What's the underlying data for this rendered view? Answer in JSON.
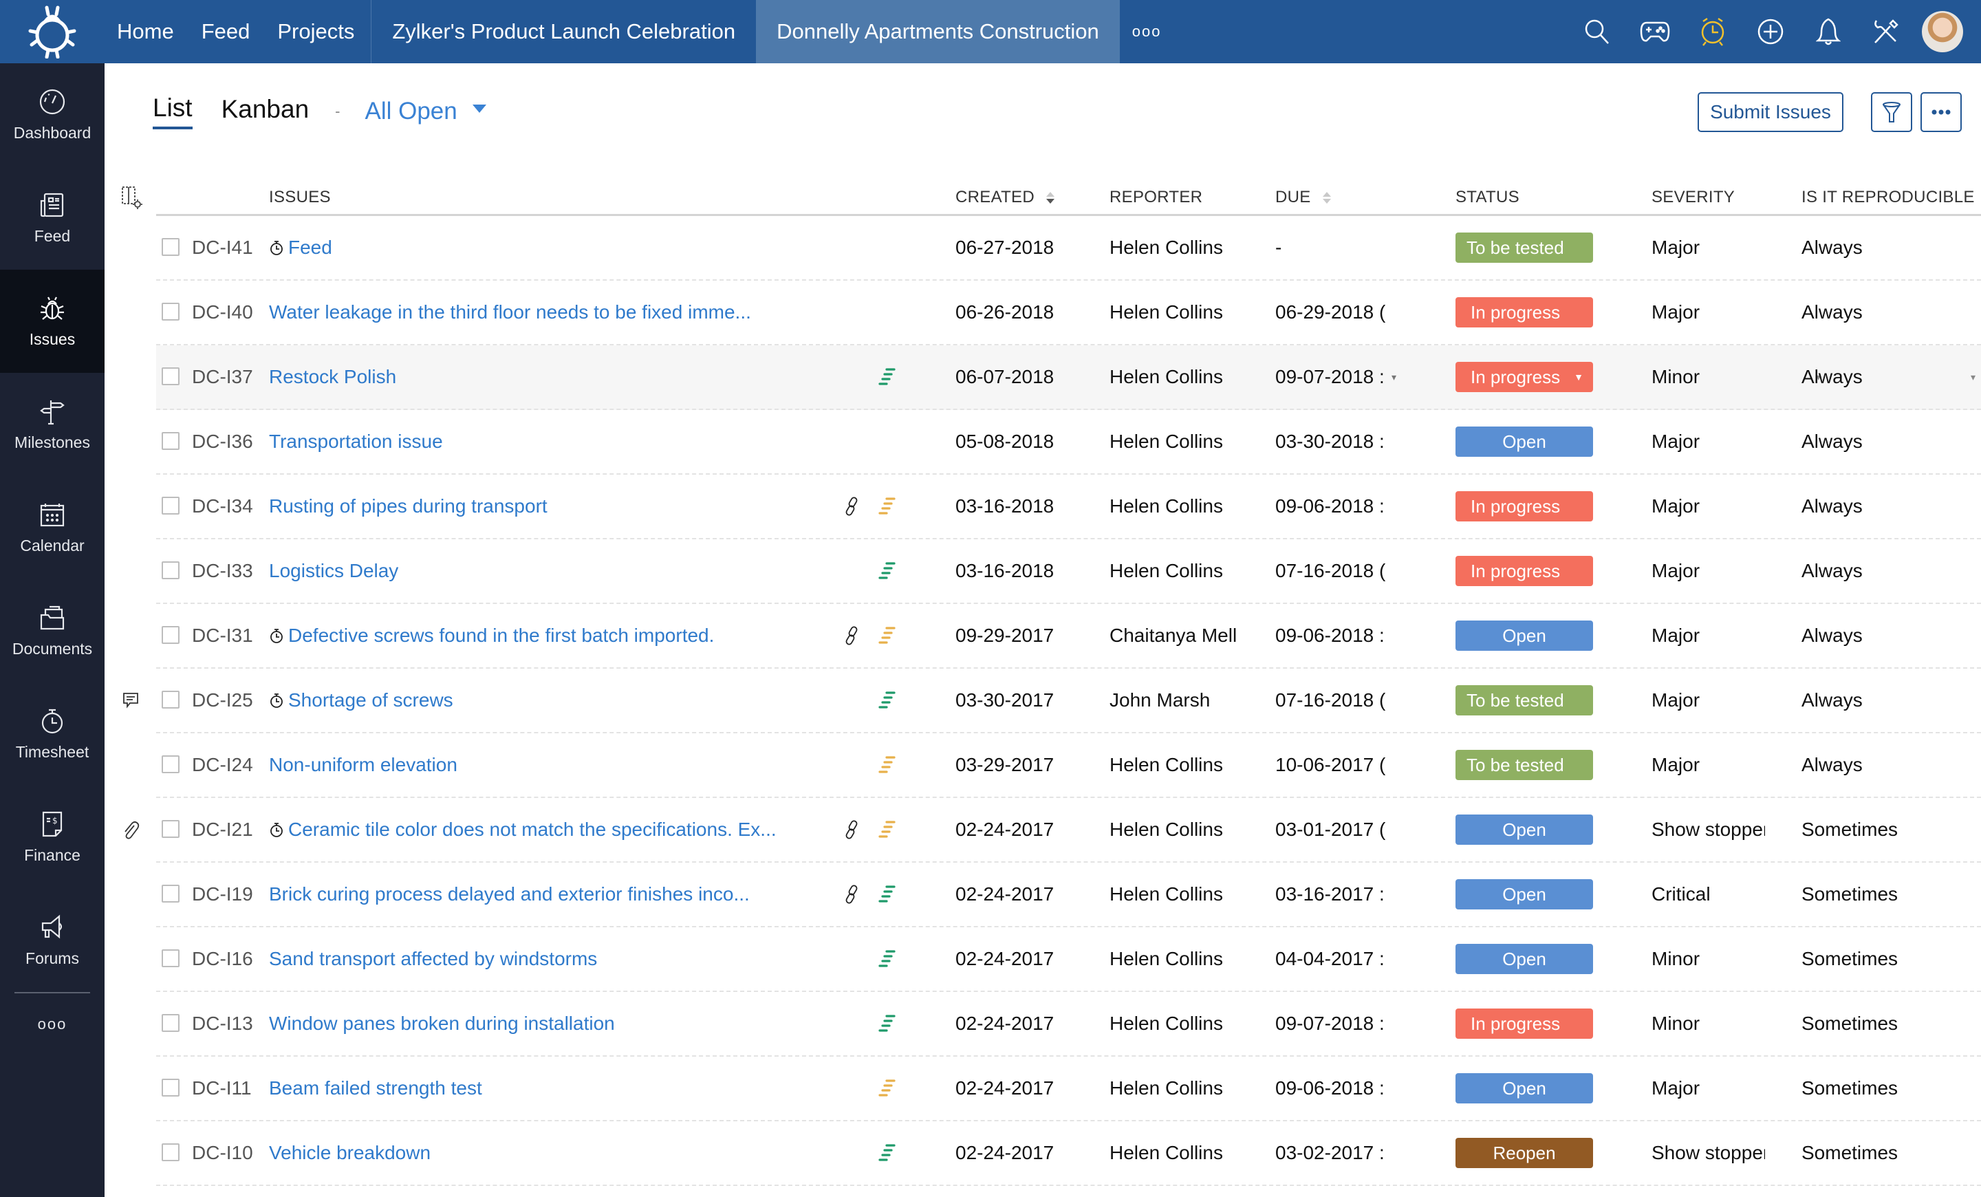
{
  "topbar": {
    "nav": [
      "Home",
      "Feed",
      "Projects"
    ],
    "projects": [
      {
        "label": "Zylker's Product Launch Celebration",
        "active": false
      },
      {
        "label": "Donnelly Apartments Construction",
        "active": true
      }
    ],
    "more": "ooo",
    "icons": [
      "search-icon",
      "game-controller-icon",
      "alarm-clock-icon",
      "add-circle-icon",
      "bell-icon",
      "tools-icon",
      "user-avatar"
    ],
    "accent_colors": {
      "bar": "#235795",
      "active_tab": "#4e7aab",
      "alarm": "#f3c12c"
    }
  },
  "sidebar": {
    "items": [
      {
        "label": "Dashboard",
        "icon": "speedometer-icon",
        "active": false
      },
      {
        "label": "Feed",
        "icon": "newspaper-icon",
        "active": false
      },
      {
        "label": "Issues",
        "icon": "bug-icon",
        "active": true
      },
      {
        "label": "Milestones",
        "icon": "signpost-icon",
        "active": false
      },
      {
        "label": "Calendar",
        "icon": "calendar-icon",
        "active": false
      },
      {
        "label": "Documents",
        "icon": "folder-icon",
        "active": false
      },
      {
        "label": "Timesheet",
        "icon": "stopwatch-icon",
        "active": false
      },
      {
        "label": "Finance",
        "icon": "invoice-icon",
        "active": false
      },
      {
        "label": "Forums",
        "icon": "megaphone-icon",
        "active": false
      }
    ],
    "more": "ooo"
  },
  "view": {
    "tabs": [
      {
        "label": "List",
        "active": true
      },
      {
        "label": "Kanban",
        "active": false
      }
    ],
    "separator": "-",
    "filter": "All Open",
    "submit_label": "Submit Issues",
    "filter_icon": "funnel-icon",
    "more_icon": "more-dots-icon"
  },
  "table": {
    "columns": {
      "issues": "ISSUES",
      "created": "CREATED",
      "reporter": "REPORTER",
      "due": "DUE",
      "status": "STATUS",
      "severity": "SEVERITY",
      "reproducible": "IS IT REPRODUCIBLE"
    },
    "sorted_by": "created",
    "rows": [
      {
        "id": "DC-I41",
        "title": "Feed",
        "timer": true,
        "link": false,
        "priority": "",
        "mark": "",
        "created": "06-27-2018",
        "reporter": "Helen Collins",
        "due": "-",
        "status": "To be tested",
        "severity": "Major",
        "reproducible": "Always"
      },
      {
        "id": "DC-I40",
        "title": "Water leakage in the third floor needs to be fixed imme...",
        "timer": false,
        "link": false,
        "priority": "",
        "mark": "",
        "created": "06-26-2018",
        "reporter": "Helen Collins",
        "due": "06-29-2018 (",
        "status": "In progress",
        "severity": "Major",
        "reproducible": "Always"
      },
      {
        "id": "DC-I37",
        "title": "Restock Polish",
        "timer": false,
        "link": false,
        "priority": "low",
        "mark": "",
        "created": "06-07-2018",
        "reporter": "Helen Collins",
        "due": "09-07-2018 :",
        "status": "In progress",
        "severity": "Minor",
        "reproducible": "Always",
        "hovered": true
      },
      {
        "id": "DC-I36",
        "title": "Transportation issue",
        "timer": false,
        "link": false,
        "priority": "",
        "mark": "",
        "created": "05-08-2018",
        "reporter": "Helen Collins",
        "due": "03-30-2018 :",
        "status": "Open",
        "severity": "Major",
        "reproducible": "Always"
      },
      {
        "id": "DC-I34",
        "title": "Rusting of pipes during transport",
        "timer": false,
        "link": true,
        "priority": "medium",
        "mark": "",
        "created": "03-16-2018",
        "reporter": "Helen Collins",
        "due": "09-06-2018 :",
        "status": "In progress",
        "severity": "Major",
        "reproducible": "Always"
      },
      {
        "id": "DC-I33",
        "title": "Logistics Delay",
        "timer": false,
        "link": false,
        "priority": "low",
        "mark": "",
        "created": "03-16-2018",
        "reporter": "Helen Collins",
        "due": "07-16-2018 (",
        "status": "In progress",
        "severity": "Major",
        "reproducible": "Always"
      },
      {
        "id": "DC-I31",
        "title": "Defective screws found in the first batch imported.",
        "timer": true,
        "link": true,
        "priority": "medium",
        "mark": "",
        "created": "09-29-2017",
        "reporter": "Chaitanya Mell",
        "due": "09-06-2018 :",
        "status": "Open",
        "severity": "Major",
        "reproducible": "Always"
      },
      {
        "id": "DC-I25",
        "title": "Shortage of screws",
        "timer": true,
        "link": false,
        "priority": "low",
        "mark": "comment",
        "created": "03-30-2017",
        "reporter": "John Marsh",
        "due": "07-16-2018 (",
        "status": "To be tested",
        "severity": "Major",
        "reproducible": "Always"
      },
      {
        "id": "DC-I24",
        "title": "Non-uniform elevation",
        "timer": false,
        "link": false,
        "priority": "medium",
        "mark": "",
        "created": "03-29-2017",
        "reporter": "Helen Collins",
        "due": "10-06-2017 (",
        "status": "To be tested",
        "severity": "Major",
        "reproducible": "Always"
      },
      {
        "id": "DC-I21",
        "title": "Ceramic tile color does not match the specifications. Ex...",
        "timer": true,
        "link": true,
        "priority": "medium",
        "mark": "attachment",
        "created": "02-24-2017",
        "reporter": "Helen Collins",
        "due": "03-01-2017 (",
        "status": "Open",
        "severity": "Show stopper",
        "reproducible": "Sometimes"
      },
      {
        "id": "DC-I19",
        "title": "Brick curing process delayed and exterior finishes inco...",
        "timer": false,
        "link": true,
        "priority": "low",
        "mark": "",
        "created": "02-24-2017",
        "reporter": "Helen Collins",
        "due": "03-16-2017 :",
        "status": "Open",
        "severity": "Critical",
        "reproducible": "Sometimes"
      },
      {
        "id": "DC-I16",
        "title": "Sand transport affected by windstorms",
        "timer": false,
        "link": false,
        "priority": "low",
        "mark": "",
        "created": "02-24-2017",
        "reporter": "Helen Collins",
        "due": "04-04-2017 :",
        "status": "Open",
        "severity": "Minor",
        "reproducible": "Sometimes"
      },
      {
        "id": "DC-I13",
        "title": "Window panes broken during installation",
        "timer": false,
        "link": false,
        "priority": "low",
        "mark": "",
        "created": "02-24-2017",
        "reporter": "Helen Collins",
        "due": "09-07-2018 :",
        "status": "In progress",
        "severity": "Minor",
        "reproducible": "Sometimes"
      },
      {
        "id": "DC-I11",
        "title": "Beam failed strength test",
        "timer": false,
        "link": false,
        "priority": "medium",
        "mark": "",
        "created": "02-24-2017",
        "reporter": "Helen Collins",
        "due": "09-06-2018 :",
        "status": "Open",
        "severity": "Major",
        "reproducible": "Sometimes"
      },
      {
        "id": "DC-I10",
        "title": "Vehicle breakdown",
        "timer": false,
        "link": false,
        "priority": "low",
        "mark": "",
        "created": "02-24-2017",
        "reporter": "Helen Collins",
        "due": "03-02-2017 :",
        "status": "Reopen",
        "severity": "Show stopper",
        "reproducible": "Sometimes"
      }
    ],
    "status_colors": {
      "To be tested": "#8fb062",
      "In progress": "#f46f5d",
      "Open": "#5a8fd3",
      "Reopen": "#925a24"
    },
    "priority_colors": {
      "low": "#1f9a6a",
      "medium": "#e8b04a"
    }
  }
}
